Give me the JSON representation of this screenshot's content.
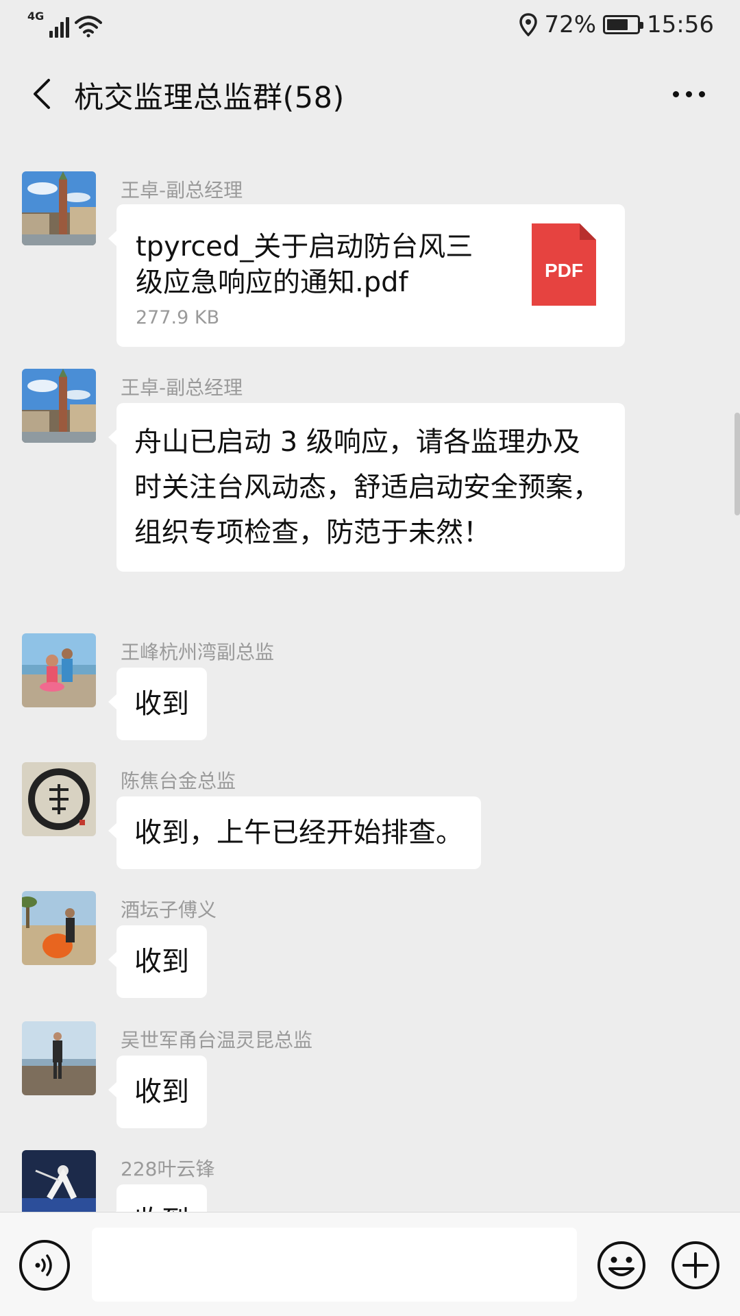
{
  "status_bar": {
    "network": "4G",
    "battery_percent": "72%",
    "battery_level": 0.72,
    "time": "15:56"
  },
  "header": {
    "title": "杭交监理总监群(58)"
  },
  "messages": [
    {
      "sender": "王卓-副总经理",
      "type": "file",
      "file_name": "tpyrced_关于启动防台风三级应急响应的通知.pdf",
      "file_size": "277.9 KB",
      "file_icon": "PDF"
    },
    {
      "sender": "王卓-副总经理",
      "type": "text",
      "text": "舟山已启动 3 级响应，请各监理办及时关注台风动态，舒适启动安全预案，组织专项检查，防范于未然！"
    },
    {
      "sender": "王峰杭州湾副总监",
      "type": "text",
      "text": "收到"
    },
    {
      "sender": "陈焦台金总监",
      "type": "text",
      "text": "收到，上午已经开始排查。"
    },
    {
      "sender": "酒坛子傅义",
      "type": "text",
      "text": "收到"
    },
    {
      "sender": "吴世军甬台温灵昆总监",
      "type": "text",
      "text": "收到"
    },
    {
      "sender": "228叶云锋",
      "type": "text",
      "text": "收到"
    }
  ],
  "input_bar": {
    "placeholder": ""
  },
  "colors": {
    "background": "#ededed",
    "bubble": "#ffffff",
    "pdf_red": "#e64340",
    "sender_gray": "#9a9a9a"
  }
}
